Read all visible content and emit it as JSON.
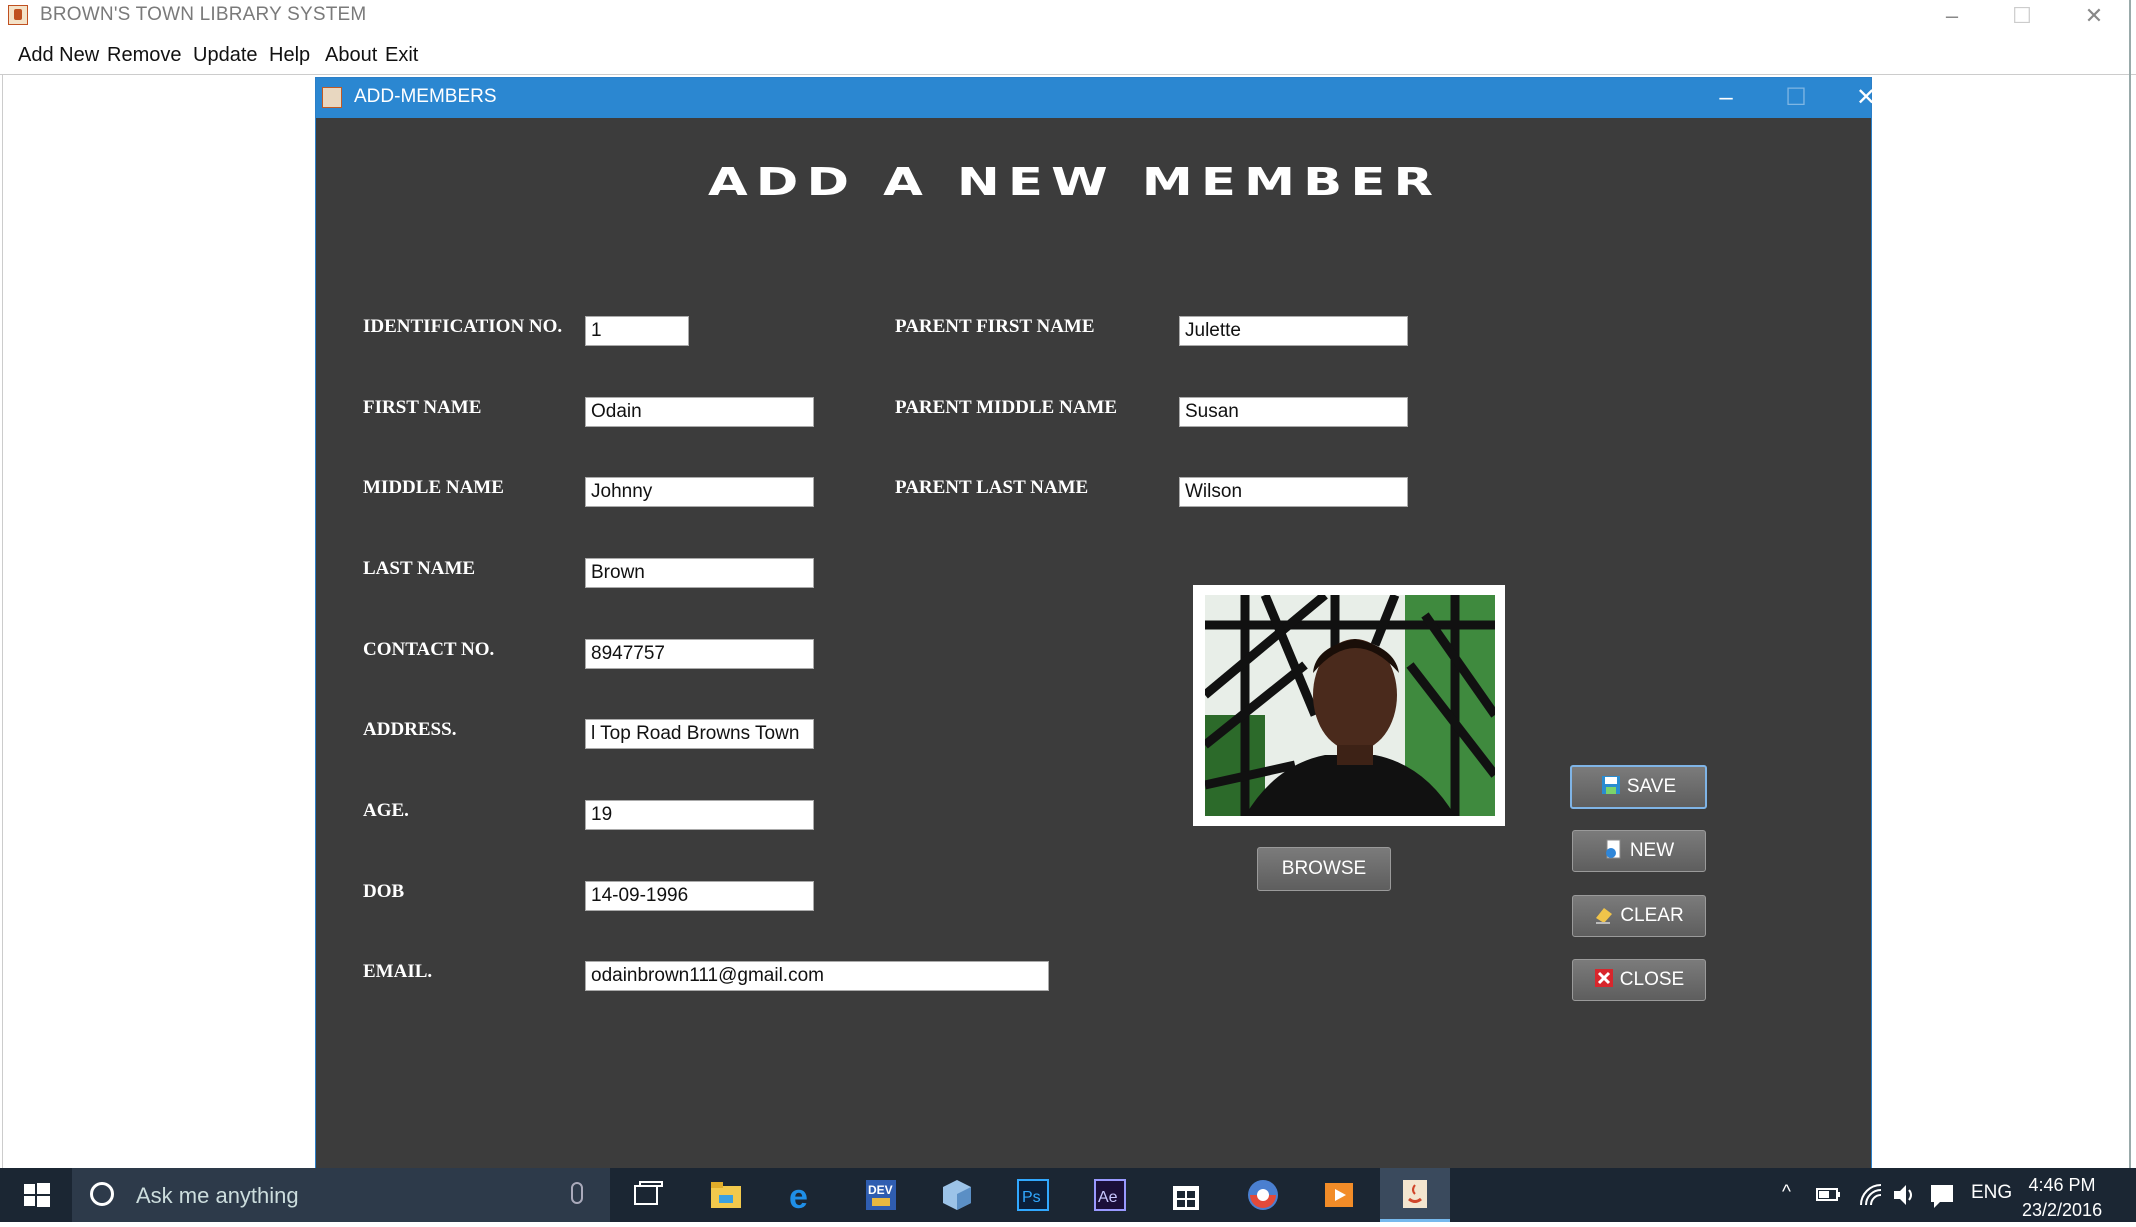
{
  "main_window": {
    "title": "BROWN'S TOWN LIBRARY SYSTEM",
    "menu": [
      "Add New",
      "Remove",
      "Update",
      "Help",
      "About",
      "Exit"
    ]
  },
  "frame": {
    "title": "ADD-MEMBERS",
    "heading": "ADD A NEW MEMBER"
  },
  "form": {
    "id": {
      "label": "IDENTIFICATION NO.",
      "value": "1"
    },
    "first_name": {
      "label": "FIRST NAME",
      "value": "Odain"
    },
    "middle_name": {
      "label": "MIDDLE NAME",
      "value": "Johnny"
    },
    "last_name": {
      "label": "LAST NAME",
      "value": "Brown"
    },
    "contact": {
      "label": "CONTACT NO.",
      "value": "8947757"
    },
    "address": {
      "label": "ADDRESS.",
      "value": "l Top Road Browns Town"
    },
    "age": {
      "label": "AGE.",
      "value": "19"
    },
    "dob": {
      "label": "DOB",
      "value": "14-09-1996"
    },
    "email": {
      "label": "EMAIL.",
      "value": "odainbrown111@gmail.com"
    },
    "parent_first": {
      "label": "PARENT FIRST NAME",
      "value": "Julette"
    },
    "parent_middle": {
      "label": "PARENT MIDDLE NAME",
      "value": "Susan"
    },
    "parent_last": {
      "label": "PARENT LAST NAME",
      "value": "Wilson"
    }
  },
  "buttons": {
    "browse": "BROWSE",
    "save": "SAVE",
    "new": "NEW",
    "clear": "CLEAR",
    "close": "CLOSE"
  },
  "taskbar": {
    "search_placeholder": "Ask me anything",
    "language": "ENG",
    "time": "4:46 PM",
    "date": "23/2/2016",
    "icons": [
      "windows-start-icon",
      "cortana-icon",
      "microphone-icon",
      "task-view-icon",
      "file-explorer-icon",
      "edge-icon",
      "dev-icon",
      "virtualbox-icon",
      "photoshop-icon",
      "after-effects-icon",
      "store-icon",
      "browser-icon",
      "media-player-icon",
      "java-icon"
    ]
  },
  "colors": {
    "frame_title": "#2b87d1",
    "frame_background": "#3c3c3c",
    "taskbar": "#1b2633"
  }
}
